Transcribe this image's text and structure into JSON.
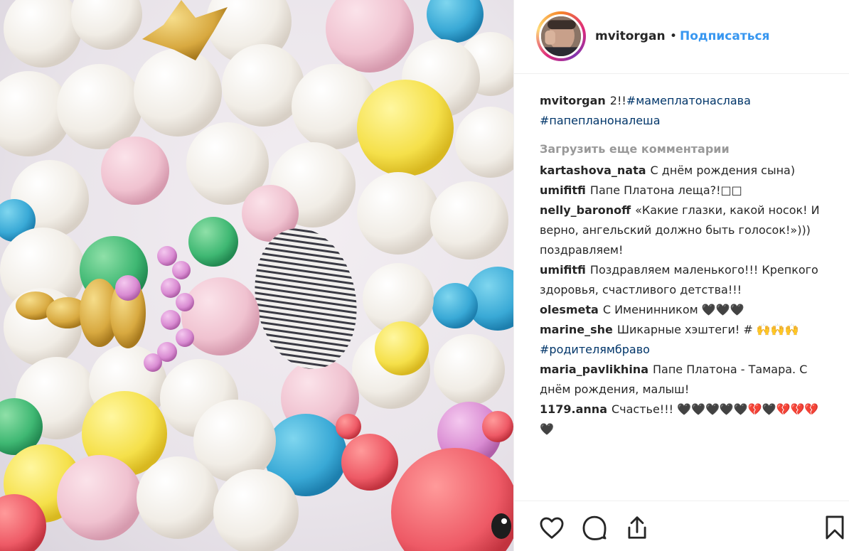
{
  "post": {
    "username": "mvitorgan",
    "separator": "•",
    "follow_label": "Подписаться"
  },
  "caption": {
    "username": "mvitorgan",
    "text": "2!!",
    "hashtag_1": "#мамеплатонаслава",
    "hashtag_2": "#папепланоналеша"
  },
  "load_more_label": "Загрузить еще комментарии",
  "comments": [
    {
      "username": "kartashova_nata",
      "text": "С днём рождения сына)"
    },
    {
      "username": "umifitfi",
      "text": "Папе Платона леща?!□□"
    },
    {
      "username": "nelly_baronoff",
      "text": "«Какие глазки, какой носок! И верно, ангельский должно быть голосок!»))) поздравляем!"
    },
    {
      "username": "umifitfi",
      "text": "Поздравляем маленького!!! Крепкого здоровья, счастливого детства!!!"
    },
    {
      "username": "olesmeta",
      "text": "С Именинником 🖤🖤🖤"
    },
    {
      "username": "marine_she",
      "text": "Шикарные хэштеги! # 🙌🙌🙌",
      "hashtag": "#родителямбраво"
    },
    {
      "username": "maria_pavlikhina",
      "text": "Папе Платона - Тамара. С днём рождения, малыш!"
    },
    {
      "username": "1179.anna",
      "text": "Счастье!!! 🖤🖤🖤🖤🖤💔🖤💔💔💔🖤"
    }
  ],
  "actions": {
    "like_icon": "heart-icon",
    "comment_icon": "comment-icon",
    "share_icon": "share-icon",
    "save_icon": "bookmark-icon"
  },
  "colors": {
    "link_blue": "#3897f0",
    "hashtag_blue": "#003569",
    "muted_gray": "#999999",
    "text": "#262626"
  }
}
